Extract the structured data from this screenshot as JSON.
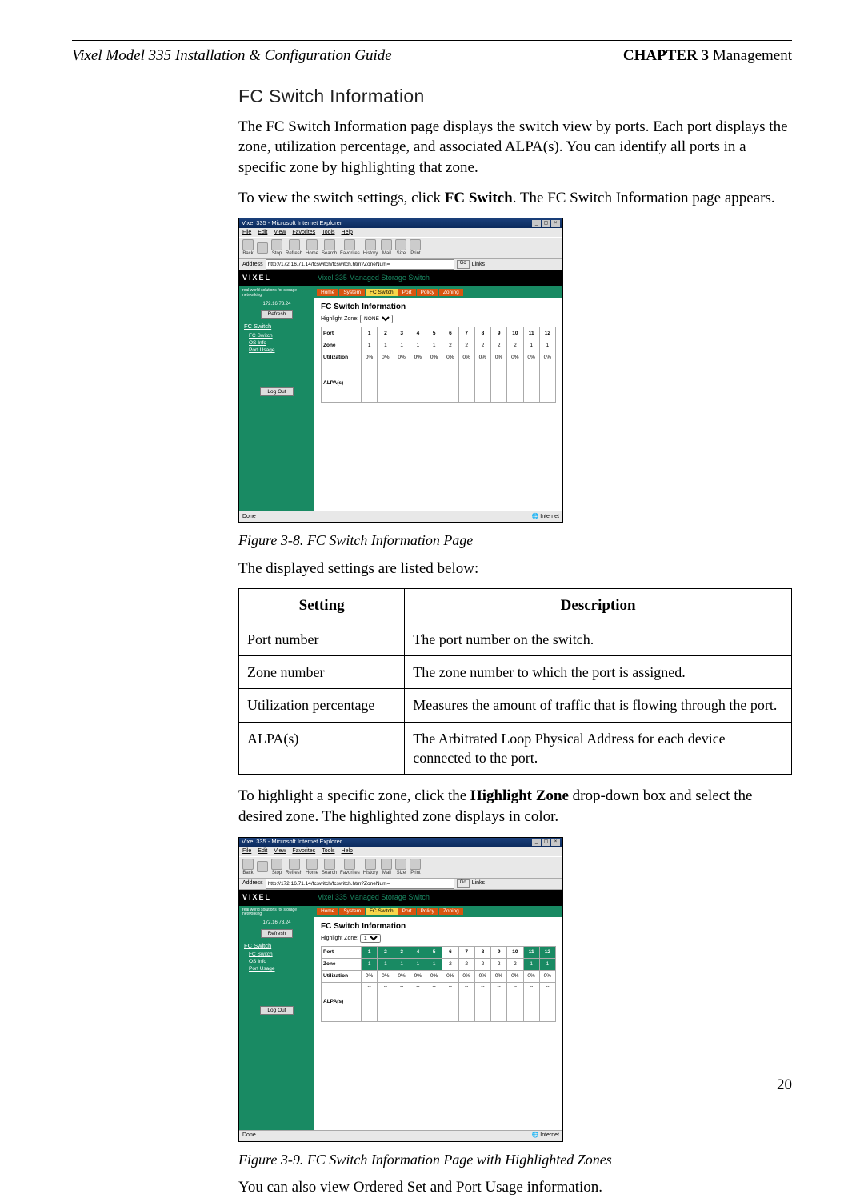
{
  "header": {
    "left": "Vixel Model 335 Installation & Configuration Guide",
    "chapter_label": "CHAPTER 3",
    "chapter_title": " Management"
  },
  "section_title": "FC Switch Information",
  "p1": "The FC Switch Information page displays the switch view by ports. Each port displays the zone, utilization percentage, and associated ALPA(s). You can identify all ports in a specific zone by highlighting that zone.",
  "p2_a": "To view the switch settings, click ",
  "p2_b": "FC Switch",
  "p2_c": ". The FC Switch Information page appears.",
  "fig1_caption": "Figure 3-8. FC Switch Information Page",
  "p3": "The displayed settings are listed below:",
  "table": {
    "head": {
      "setting": "Setting",
      "desc": "Description"
    },
    "rows": [
      {
        "setting": "Port number",
        "desc": "The port number on the switch."
      },
      {
        "setting": "Zone number",
        "desc": "The zone number to which the port is assigned."
      },
      {
        "setting": "Utilization percentage",
        "desc": "Measures the amount of traffic that is flowing through the port."
      },
      {
        "setting": "ALPA(s)",
        "desc": "The Arbitrated Loop Physical Address for each device connected to the port."
      }
    ]
  },
  "p4_a": "To highlight a specific zone, click the ",
  "p4_b": "Highlight Zone",
  "p4_c": " drop-down box and select the desired zone. The highlighted zone displays in color.",
  "fig2_caption": "Figure 3-9. FC Switch Information Page with Highlighted Zones",
  "p5": "You can also view Ordered Set and Port Usage information.",
  "page_number": "20",
  "shot": {
    "titlebar": "Vixel 335 - Microsoft Internet Explorer",
    "menus": [
      "File",
      "Edit",
      "View",
      "Favorites",
      "Tools",
      "Help"
    ],
    "tools": [
      "Back",
      "",
      "Stop",
      "Refresh",
      "Home",
      "Search",
      "Favorites",
      "History",
      "Mail",
      "Size",
      "Print"
    ],
    "addr_label": "Address",
    "addr_value": "http://172.16.71.14/fcswitch/fcswitch.htm?ZoneNum=",
    "go": "Go",
    "links": "Links",
    "logo": "VIXEL",
    "logosub": "real world solutions for storage networking",
    "banner": "Vixel 335 Managed Storage Switch",
    "tabs": [
      "Home",
      "System",
      "FC Switch",
      "Port",
      "Policy",
      "Zoning"
    ],
    "ip": "172.16.73.24",
    "refresh": "Refresh",
    "sbhead": "FC Switch",
    "sblinks": [
      "FC Switch",
      "OS Info",
      "Port Usage"
    ],
    "logout": "Log Out",
    "main_title": "FC Switch Information",
    "hz_label": "Highlight Zone:",
    "hz_val1": "NONE",
    "hz_val2": "1",
    "rowheads": [
      "Port",
      "Zone",
      "Utilization",
      "ALPA(s)"
    ],
    "ports": [
      "1",
      "2",
      "3",
      "4",
      "5",
      "6",
      "7",
      "8",
      "9",
      "10",
      "11",
      "12"
    ],
    "zones1": [
      "1",
      "1",
      "1",
      "1",
      "1",
      "2",
      "2",
      "2",
      "2",
      "2",
      "1",
      "1"
    ],
    "zones2": [
      "1",
      "1",
      "1",
      "1",
      "1",
      "2",
      "2",
      "2",
      "2",
      "2",
      "1",
      "1"
    ],
    "util": [
      "0%",
      "0%",
      "0%",
      "0%",
      "0%",
      "0%",
      "0%",
      "0%",
      "0%",
      "0%",
      "0%",
      "0%"
    ],
    "alpa": [
      "--",
      "--",
      "--",
      "--",
      "--",
      "--",
      "--",
      "--",
      "--",
      "--",
      "--",
      "--"
    ],
    "status_done": "Done",
    "status_zone": "Internet",
    "hl_zone_number": "1"
  }
}
